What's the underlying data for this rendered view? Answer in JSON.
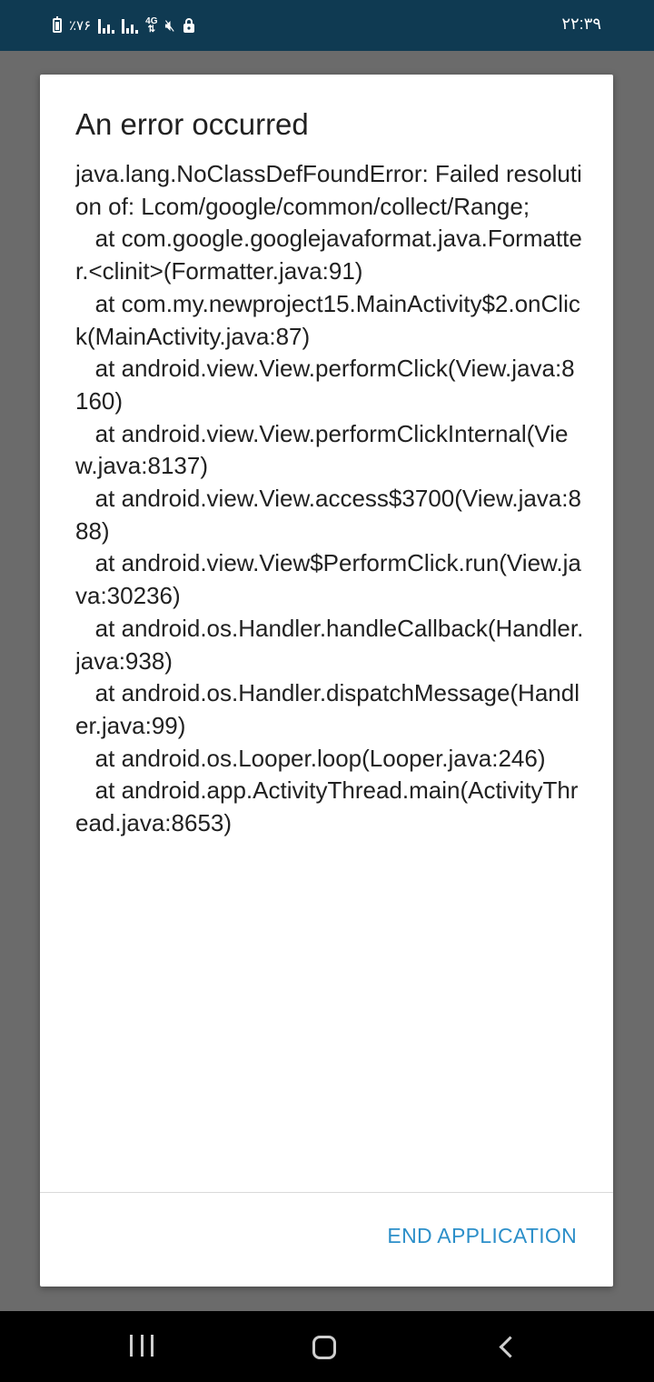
{
  "status_bar": {
    "battery_percent": "٪۷۶",
    "network_type": "4G",
    "time": "۲۲:۳۹"
  },
  "dialog": {
    "title": "An error occurred",
    "message": "java.lang.NoClassDefFoundError: Failed resolution of: Lcom/google/common/collect/Range;\n   at com.google.googlejavaformat.java.Formatter.<clinit>(Formatter.java:91)\n   at com.my.newproject15.MainActivity$2.onClick(MainActivity.java:87)\n   at android.view.View.performClick(View.java:8160)\n   at android.view.View.performClickInternal(View.java:8137)\n   at android.view.View.access$3700(View.java:888)\n   at android.view.View$PerformClick.run(View.java:30236)\n   at android.os.Handler.handleCallback(Handler.java:938)\n   at android.os.Handler.dispatchMessage(Handler.java:99)\n   at android.os.Looper.loop(Looper.java:246)\n   at android.app.ActivityThread.main(ActivityThread.java:8653)",
    "button_label": "END APPLICATION"
  },
  "colors": {
    "status_bar": "#0f3a52",
    "scrim": "#6b6b6b",
    "accent": "#2c8fc9"
  },
  "icons": {
    "status": [
      "battery-icon",
      "signal-icon",
      "signal-icon",
      "network-4g-icon",
      "mute-icon",
      "lock-icon"
    ],
    "nav": [
      "recents-icon",
      "home-icon",
      "back-icon"
    ]
  }
}
